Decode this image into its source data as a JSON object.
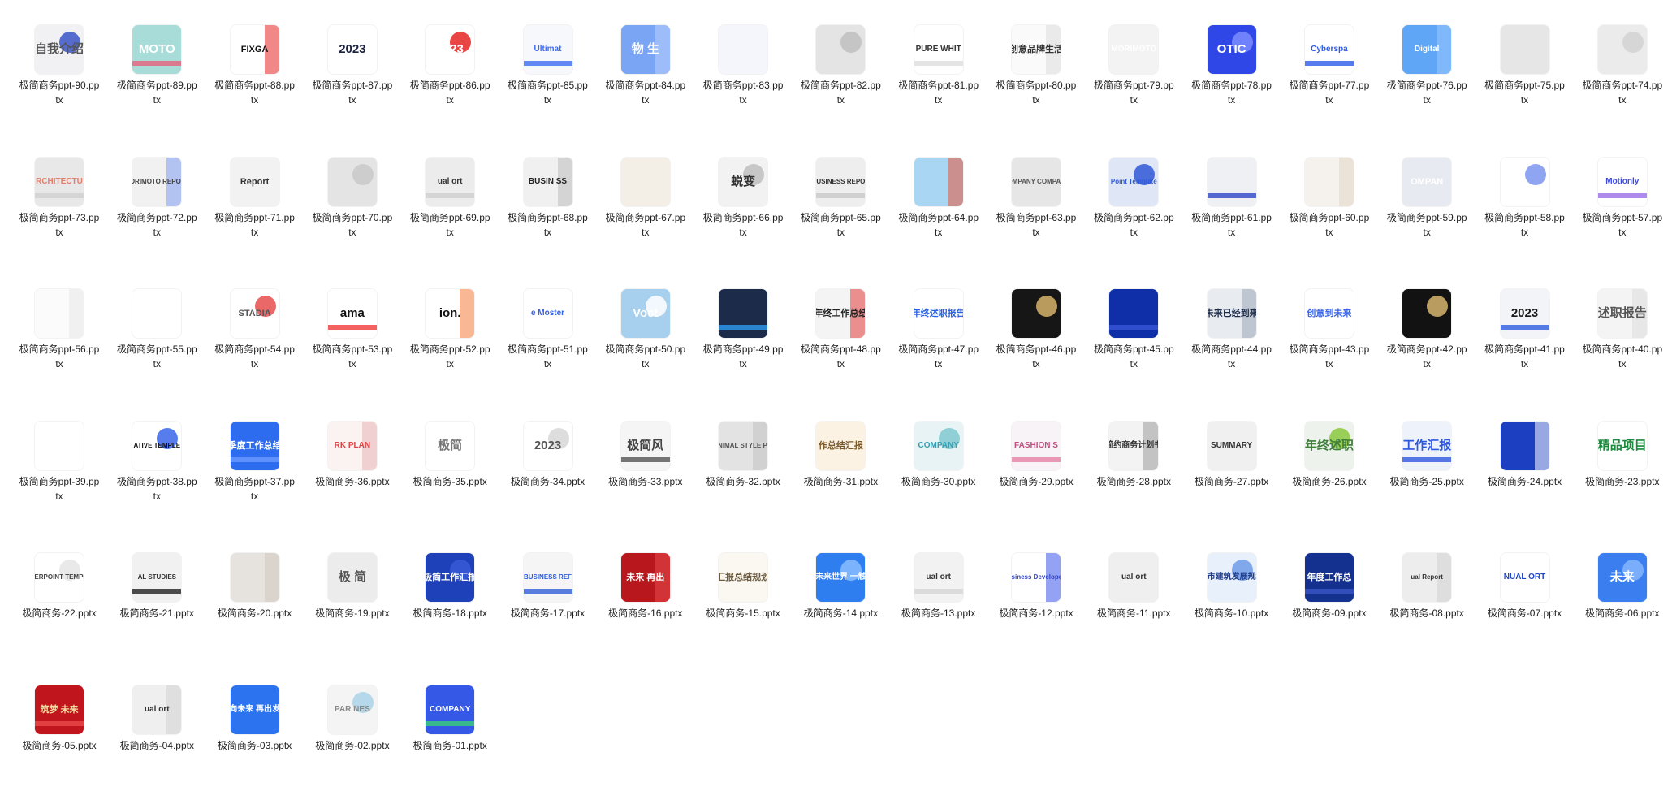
{
  "files": [
    {
      "name": "极简商务ppt-90.pptx",
      "thumb_text": "自我介绍",
      "bg": "#f1f1f3",
      "fg": "#555555",
      "accent": "#3a55c8"
    },
    {
      "name": "极简商务ppt-89.pptx",
      "thumb_text": "MOTO",
      "bg": "#a8dcd8",
      "fg": "#ffffff",
      "accent": "#e8607c"
    },
    {
      "name": "极简商务ppt-88.pptx",
      "thumb_text": "FIXGA",
      "bg": "#ffffff",
      "fg": "#111111",
      "accent": "#e52525"
    },
    {
      "name": "极简商务ppt-87.pptx",
      "thumb_text": "2023",
      "bg": "#ffffff",
      "fg": "#1c2240",
      "accent": "#2a3fd0"
    },
    {
      "name": "极简商务ppt-86.pptx",
      "thumb_text": "2023",
      "bg": "#ffffff",
      "fg": "#ffffff",
      "accent": "#e52525"
    },
    {
      "name": "极简商务ppt-85.pptx",
      "thumb_text": "Ultimat",
      "bg": "#f6f8fc",
      "fg": "#3d6bf0",
      "accent": "#3d6bf0"
    },
    {
      "name": "极简商务ppt-84.pptx",
      "thumb_text": "物 生",
      "bg": "#7aa4f4",
      "fg": "#ffffff",
      "accent": "#b9d0ff"
    },
    {
      "name": "极简商务ppt-83.pptx",
      "thumb_text": "",
      "bg": "#f4f6fb",
      "fg": "#7b4fd6",
      "accent": "#4a7df0"
    },
    {
      "name": "极简商务ppt-82.pptx",
      "thumb_text": "",
      "bg": "#e4e4e4",
      "fg": "#222222",
      "accent": "#c0c0c0"
    },
    {
      "name": "极简商务ppt-81.pptx",
      "thumb_text": "PURE WHIT",
      "bg": "#ffffff",
      "fg": "#333333",
      "accent": "#dddddd"
    },
    {
      "name": "极简商务ppt-80.pptx",
      "thumb_text": "创意品牌生活",
      "bg": "#fafafa",
      "fg": "#333333",
      "accent": "#dddddd"
    },
    {
      "name": "极简商务ppt-79.pptx",
      "thumb_text": "MORIMOTO",
      "bg": "#f3f3f3",
      "fg": "#ffffff",
      "accent": "#111111"
    },
    {
      "name": "极简商务ppt-78.pptx",
      "thumb_text": "OTIC",
      "bg": "#2f47e6",
      "fg": "#ffffff",
      "accent": "#7b8cff"
    },
    {
      "name": "极简商务ppt-77.pptx",
      "thumb_text": "Cyberspa",
      "bg": "#ffffff",
      "fg": "#2c5be8",
      "accent": "#2c5be8"
    },
    {
      "name": "极简商务ppt-76.pptx",
      "thumb_text": "Digital",
      "bg": "#5fa6f6",
      "fg": "#ffffff",
      "accent": "#9ac8ff"
    },
    {
      "name": "极简商务ppt-75.pptx",
      "thumb_text": "",
      "bg": "#e6e6e6",
      "fg": "#333333",
      "accent": "#bdbdbd"
    },
    {
      "name": "极简商务ppt-74.pptx",
      "thumb_text": "",
      "bg": "#ebebeb",
      "fg": "#333333",
      "accent": "#d2d2d2"
    },
    {
      "name": "极简商务ppt-73.pptx",
      "thumb_text": "RCHITECTU",
      "bg": "#e8e8e8",
      "fg": "#e77c6a",
      "accent": "#cfcfcf"
    },
    {
      "name": "极简商务ppt-72.pptx",
      "thumb_text": "MORIMOTO REPORT",
      "bg": "#f1f1f1",
      "fg": "#444444",
      "accent": "#7d9cf0"
    },
    {
      "name": "极简商务ppt-71.pptx",
      "thumb_text": "Report",
      "bg": "#f2f2f2",
      "fg": "#333333",
      "accent": "#bcbcbc"
    },
    {
      "name": "极简商务ppt-70.pptx",
      "thumb_text": "",
      "bg": "#e4e4e4",
      "fg": "#333333",
      "accent": "#c9c9c9"
    },
    {
      "name": "极简商务ppt-69.pptx",
      "thumb_text": "ual ort",
      "bg": "#ececec",
      "fg": "#333333",
      "accent": "#d0d0d0"
    },
    {
      "name": "极简商务ppt-68.pptx",
      "thumb_text": "BUSIN SS",
      "bg": "#f0f0f0",
      "fg": "#222222",
      "accent": "#bdbdbd"
    },
    {
      "name": "极简商务ppt-67.pptx",
      "thumb_text": "",
      "bg": "#f3efe6",
      "fg": "#7a6a50",
      "accent": "#e8d9b8"
    },
    {
      "name": "极简商务ppt-66.pptx",
      "thumb_text": "蜕变",
      "bg": "#f2f2f2",
      "fg": "#333333",
      "accent": "#c0c0c0"
    },
    {
      "name": "极简商务ppt-65.pptx",
      "thumb_text": "BUSINESS REPOR",
      "bg": "#eeeeee",
      "fg": "#333333",
      "accent": "#c8c8c8"
    },
    {
      "name": "极简商务ppt-64.pptx",
      "thumb_text": "",
      "bg": "#a9d6f2",
      "fg": "#ffffff",
      "accent": "#e8553d"
    },
    {
      "name": "极简商务ppt-63.pptx",
      "thumb_text": "COMPANY COMPANY",
      "bg": "#e6e6e6",
      "fg": "#555555",
      "accent": "#cccccc"
    },
    {
      "name": "极简商务ppt-62.pptx",
      "thumb_text": "Point Template",
      "bg": "#dfe7f7",
      "fg": "#2f58d6",
      "accent": "#2f58d6"
    },
    {
      "name": "极简商务ppt-61.pptx",
      "thumb_text": "",
      "bg": "#eef0f4",
      "fg": "#2c47c8",
      "accent": "#2c47c8"
    },
    {
      "name": "极简商务ppt-60.pptx",
      "thumb_text": "",
      "bg": "#f5f2ee",
      "fg": "#b39a78",
      "accent": "#e3d7c7"
    },
    {
      "name": "极简商务ppt-59.pptx",
      "thumb_text": "OMPAN",
      "bg": "#e7ebf1",
      "fg": "#ffffff",
      "accent": "#24334f"
    },
    {
      "name": "极简商务ppt-58.pptx",
      "thumb_text": "",
      "bg": "#ffffff",
      "fg": "#2c47c8",
      "accent": "#7d95ef"
    },
    {
      "name": "极简商务ppt-57.pptx",
      "thumb_text": "Motionly",
      "bg": "#ffffff",
      "fg": "#3d4ad8",
      "accent": "#9b6de8"
    },
    {
      "name": "极简商务ppt-56.pptx",
      "thumb_text": "",
      "bg": "#fbfbfb",
      "fg": "#d54444",
      "accent": "#e8e8e8"
    },
    {
      "name": "极简商务ppt-55.pptx",
      "thumb_text": "",
      "bg": "#ffffff",
      "fg": "#e84d4d",
      "accent": "#e84d4d"
    },
    {
      "name": "极简商务ppt-54.pptx",
      "thumb_text": "STADIA",
      "bg": "#ffffff",
      "fg": "#555555",
      "accent": "#e84d4d"
    },
    {
      "name": "极简商务ppt-53.pptx",
      "thumb_text": "ama",
      "bg": "#ffffff",
      "fg": "#111111",
      "accent": "#f03a3a"
    },
    {
      "name": "极简商务ppt-52.pptx",
      "thumb_text": "ion.",
      "bg": "#ffffff",
      "fg": "#111111",
      "accent": "#f47b3c"
    },
    {
      "name": "极简商务ppt-51.pptx",
      "thumb_text": "e Moster",
      "bg": "#ffffff",
      "fg": "#3561e8",
      "accent": "#3561e8"
    },
    {
      "name": "极简商务ppt-50.pptx",
      "thumb_text": "Voct",
      "bg": "#a7cfee",
      "fg": "#ffffff",
      "accent": "#ffffff"
    },
    {
      "name": "极简商务ppt-49.pptx",
      "thumb_text": "",
      "bg": "#1c2b4a",
      "fg": "#ffffff",
      "accent": "#2e9cf2"
    },
    {
      "name": "极简商务ppt-48.pptx",
      "thumb_text": "年终工作总结",
      "bg": "#f4f4f4",
      "fg": "#222222",
      "accent": "#e23b3b"
    },
    {
      "name": "极简商务ppt-47.pptx",
      "thumb_text": "年终述职报告",
      "bg": "#ffffff",
      "fg": "#2a62e0",
      "accent": "#2a62e0"
    },
    {
      "name": "极简商务ppt-46.pptx",
      "thumb_text": "",
      "bg": "#161616",
      "fg": "#d6b36a",
      "accent": "#d6b36a"
    },
    {
      "name": "极简商务ppt-45.pptx",
      "thumb_text": "",
      "bg": "#0f2fa8",
      "fg": "#ffffff",
      "accent": "#3756d6"
    },
    {
      "name": "极简商务ppt-44.pptx",
      "thumb_text": "未来已经到来",
      "bg": "#e8ebef",
      "fg": "#1e2c4a",
      "accent": "#9aa7ba"
    },
    {
      "name": "极简商务ppt-43.pptx",
      "thumb_text": "创意到未来",
      "bg": "#ffffff",
      "fg": "#3a64e8",
      "accent": "#f3c12a"
    },
    {
      "name": "极简商务ppt-42.pptx",
      "thumb_text": "",
      "bg": "#121212",
      "fg": "#d7b66e",
      "accent": "#d7b66e"
    },
    {
      "name": "极简商务ppt-41.pptx",
      "thumb_text": "2023",
      "bg": "#f3f4f8",
      "fg": "#1a1a1a",
      "accent": "#2a5be0"
    },
    {
      "name": "极简商务ppt-40.pptx",
      "thumb_text": "述职报告",
      "bg": "#f4f4f4",
      "fg": "#555555",
      "accent": "#dddddd"
    },
    {
      "name": "极简商务ppt-39.pptx",
      "thumb_text": "",
      "bg": "#ffffff",
      "fg": "#2b3fd6",
      "accent": "#2b3fd6"
    },
    {
      "name": "极简商务ppt-38.pptx",
      "thumb_text": "ATIVE TEMPLE",
      "bg": "#ffffff",
      "fg": "#111111",
      "accent": "#3a66ea"
    },
    {
      "name": "极简商务ppt-37.pptx",
      "thumb_text": "季度工作总结",
      "bg": "#2e6cef",
      "fg": "#ffffff",
      "accent": "#6a9bff"
    },
    {
      "name": "极简商务-36.pptx",
      "thumb_text": "RK PLAN",
      "bg": "#fbf2f2",
      "fg": "#d84545",
      "accent": "#e8b4b4"
    },
    {
      "name": "极简商务-35.pptx",
      "thumb_text": "极简",
      "bg": "#ffffff",
      "fg": "#777777",
      "accent": "#dddddd"
    },
    {
      "name": "极简商务-34.pptx",
      "thumb_text": "2023",
      "bg": "#ffffff",
      "fg": "#555555",
      "accent": "#d7d7d7"
    },
    {
      "name": "极简商务-33.pptx",
      "thumb_text": "极简风",
      "bg": "#f5f5f5",
      "fg": "#444444",
      "accent": "#555555"
    },
    {
      "name": "极简商务-32.pptx",
      "thumb_text": "MINIMAL STYLE PPT",
      "bg": "#e3e3e3",
      "fg": "#555555",
      "accent": "#c2c2c2"
    },
    {
      "name": "极简商务-31.pptx",
      "thumb_text": "作总结汇报",
      "bg": "#fbf2e4",
      "fg": "#7a5a2a",
      "accent": "#f0c36a"
    },
    {
      "name": "极简商务-30.pptx",
      "thumb_text": "COMPANY",
      "bg": "#e7f3f4",
      "fg": "#3a9cb0",
      "accent": "#7fc8cf"
    },
    {
      "name": "极简商务-29.pptx",
      "thumb_text": "FASHION S",
      "bg": "#f7f3f6",
      "fg": "#c05080",
      "accent": "#e67fa6"
    },
    {
      "name": "极简商务-28.pptx",
      "thumb_text": "简约商务计划书",
      "bg": "#f3f3f3",
      "fg": "#333333",
      "accent": "#9a9a9a"
    },
    {
      "name": "极简商务-27.pptx",
      "thumb_text": "SUMMARY",
      "bg": "#f0f0f0",
      "fg": "#333333",
      "accent": "#9a9a9a"
    },
    {
      "name": "极简商务-26.pptx",
      "thumb_text": "年终述职",
      "bg": "#eef2ec",
      "fg": "#3f7f3a",
      "accent": "#8ac83e"
    },
    {
      "name": "极简商务-25.pptx",
      "thumb_text": "工作汇报",
      "bg": "#eef3fb",
      "fg": "#2d57e0",
      "accent": "#2d57e0"
    },
    {
      "name": "极简商务-24.pptx",
      "thumb_text": "",
      "bg": "#1c3fc2",
      "fg": "#ffffff",
      "accent": "#ffffff"
    },
    {
      "name": "极简商务-23.pptx",
      "thumb_text": "精品项目",
      "bg": "#ffffff",
      "fg": "#1a8a3c",
      "accent": "#1a8a3c"
    },
    {
      "name": "极简商务-22.pptx",
      "thumb_text": "POWERPOINT TEMPLATE",
      "bg": "#ffffff",
      "fg": "#444444",
      "accent": "#e5e5e5"
    },
    {
      "name": "极简商务-21.pptx",
      "thumb_text": "AL STUDIES",
      "bg": "#f1f1f1",
      "fg": "#333333",
      "accent": "#222222"
    },
    {
      "name": "极简商务-20.pptx",
      "thumb_text": "",
      "bg": "#e6e2de",
      "fg": "#666666",
      "accent": "#cfc8c0"
    },
    {
      "name": "极简商务-19.pptx",
      "thumb_text": "极 简",
      "bg": "#ececec",
      "fg": "#555555",
      "accent": "#d5d5d5"
    },
    {
      "name": "极简商务-18.pptx",
      "thumb_text": "极简工作汇报",
      "bg": "#1e40b8",
      "fg": "#ffffff",
      "accent": "#3a5ad6"
    },
    {
      "name": "极简商务-17.pptx",
      "thumb_text": "BUSINESS REF",
      "bg": "#f5f5f5",
      "fg": "#2f5ed8",
      "accent": "#2f5ed8"
    },
    {
      "name": "极简商务-16.pptx",
      "thumb_text": "未来 再出",
      "bg": "#b8171d",
      "fg": "#ffffff",
      "accent": "#e84a4a"
    },
    {
      "name": "极简商务-15.pptx",
      "thumb_text": "汇报总结规划",
      "bg": "#fbf8f2",
      "fg": "#6a5a40",
      "accent": "#e0b964"
    },
    {
      "name": "极简商务-14.pptx",
      "thumb_text": "未来世界 一触",
      "bg": "#2e7ef0",
      "fg": "#ffffff",
      "accent": "#8abcff"
    },
    {
      "name": "极简商务-13.pptx",
      "thumb_text": "ual ort",
      "bg": "#f2f2f2",
      "fg": "#333333",
      "accent": "#d5d5d5"
    },
    {
      "name": "极简商务-12.pptx",
      "thumb_text": "usiness Developer",
      "bg": "#ffffff",
      "fg": "#3344c0",
      "accent": "#3a56e8"
    },
    {
      "name": "极简商务-11.pptx",
      "thumb_text": "ual ort",
      "bg": "#efefef",
      "fg": "#333333",
      "accent": "#d2d2d2"
    },
    {
      "name": "极简商务-10.pptx",
      "thumb_text": "城市建筑发展规划",
      "bg": "#e8f0fb",
      "fg": "#1f3d8a",
      "accent": "#6f9be8"
    },
    {
      "name": "极简商务-09.pptx",
      "thumb_text": "年度工作总",
      "bg": "#15318f",
      "fg": "#ffffff",
      "accent": "#3956c6"
    },
    {
      "name": "极简商务-08.pptx",
      "thumb_text": "ual Report",
      "bg": "#ededed",
      "fg": "#333333",
      "accent": "#d2d2d2"
    },
    {
      "name": "极简商务-07.pptx",
      "thumb_text": "NUAL ORT",
      "bg": "#ffffff",
      "fg": "#1e46c8",
      "accent": "#1e46c8"
    },
    {
      "name": "极简商务-06.pptx",
      "thumb_text": "未来",
      "bg": "#3b7ef0",
      "fg": "#ffffff",
      "accent": "#87b5ff"
    },
    {
      "name": "极简商务-05.pptx",
      "thumb_text": "筑梦 未来",
      "bg": "#c0151c",
      "fg": "#f4d9a0",
      "accent": "#e84a4a"
    },
    {
      "name": "极简商务-04.pptx",
      "thumb_text": "ual ort",
      "bg": "#efefef",
      "fg": "#333333",
      "accent": "#d2d2d2"
    },
    {
      "name": "极简商务-03.pptx",
      "thumb_text": "向未来 再出发",
      "bg": "#2c73ef",
      "fg": "#ffffff",
      "accent": "#8ab7ff"
    },
    {
      "name": "极简商务-02.pptx",
      "thumb_text": "PAR NES",
      "bg": "#f4f4f4",
      "fg": "#888888",
      "accent": "#a9d3e8"
    },
    {
      "name": "极简商务-01.pptx",
      "thumb_text": "COMPANY",
      "bg": "#3558e6",
      "fg": "#ffffff",
      "accent": "#3bd17a"
    }
  ]
}
